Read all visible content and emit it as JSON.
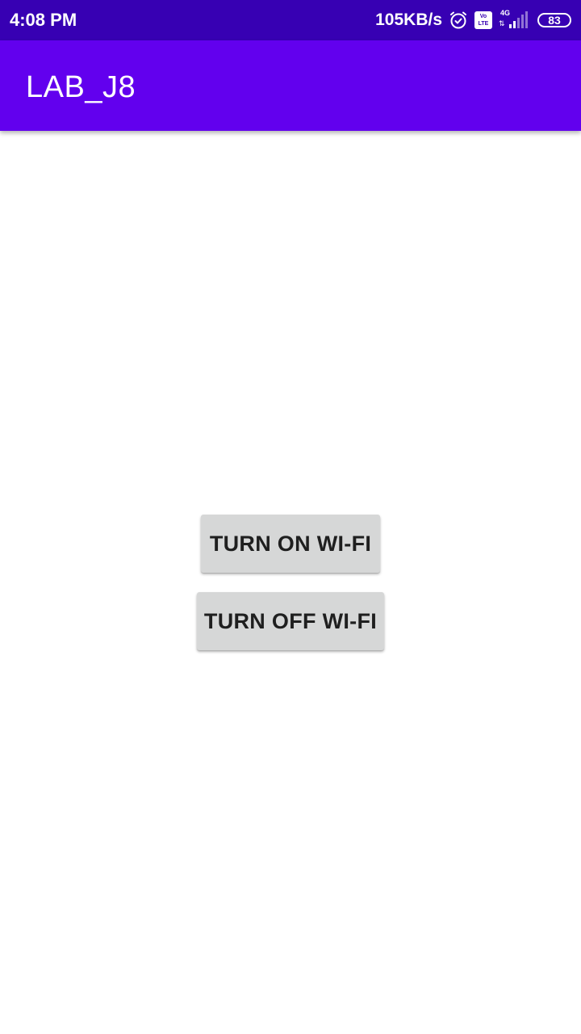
{
  "status_bar": {
    "time": "4:08 PM",
    "net_speed": "105KB/s",
    "volte_top": "Vo",
    "volte_bottom": "LTE",
    "network_type": "4G",
    "data_arrows": "⇅",
    "battery_level": "83",
    "icons": [
      "alarm-icon",
      "volte-icon",
      "signal-icon",
      "battery-icon"
    ]
  },
  "app_bar": {
    "title": "LAB_J8"
  },
  "main": {
    "turn_on_label": "TURN ON WI-FI",
    "turn_off_label": "TURN OFF WI-FI"
  },
  "colors": {
    "status_bar": "#3700b3",
    "app_bar": "#6200ee",
    "button_bg": "#d6d7d7",
    "button_text": "#1f1f1f"
  }
}
